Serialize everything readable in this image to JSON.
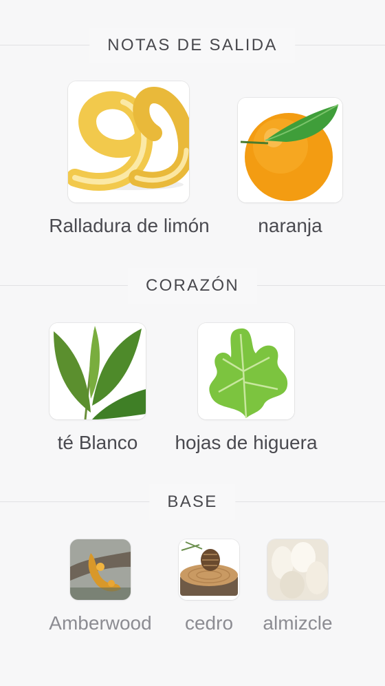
{
  "sections": [
    {
      "title": "NOTAS DE SALIDA",
      "notes": [
        {
          "label": "Ralladura de limón",
          "icon": "lemon-zest-image"
        },
        {
          "label": "naranja",
          "icon": "orange-image"
        }
      ]
    },
    {
      "title": "CORAZÓN",
      "notes": [
        {
          "label": "té Blanco",
          "icon": "tea-leaves-image"
        },
        {
          "label": "hojas de higuera",
          "icon": "fig-leaf-image"
        }
      ]
    },
    {
      "title": "BASE",
      "notes": [
        {
          "label": "Amberwood",
          "icon": "amber-resin-image"
        },
        {
          "label": "cedro",
          "icon": "cedar-log-image"
        },
        {
          "label": "almizcle",
          "icon": "musk-fluff-image"
        }
      ]
    }
  ],
  "colors": {
    "background": "#f7f7f8",
    "text": "#4a4a50",
    "muted_text": "#8c8c92",
    "rule": "#e1e1e4"
  }
}
